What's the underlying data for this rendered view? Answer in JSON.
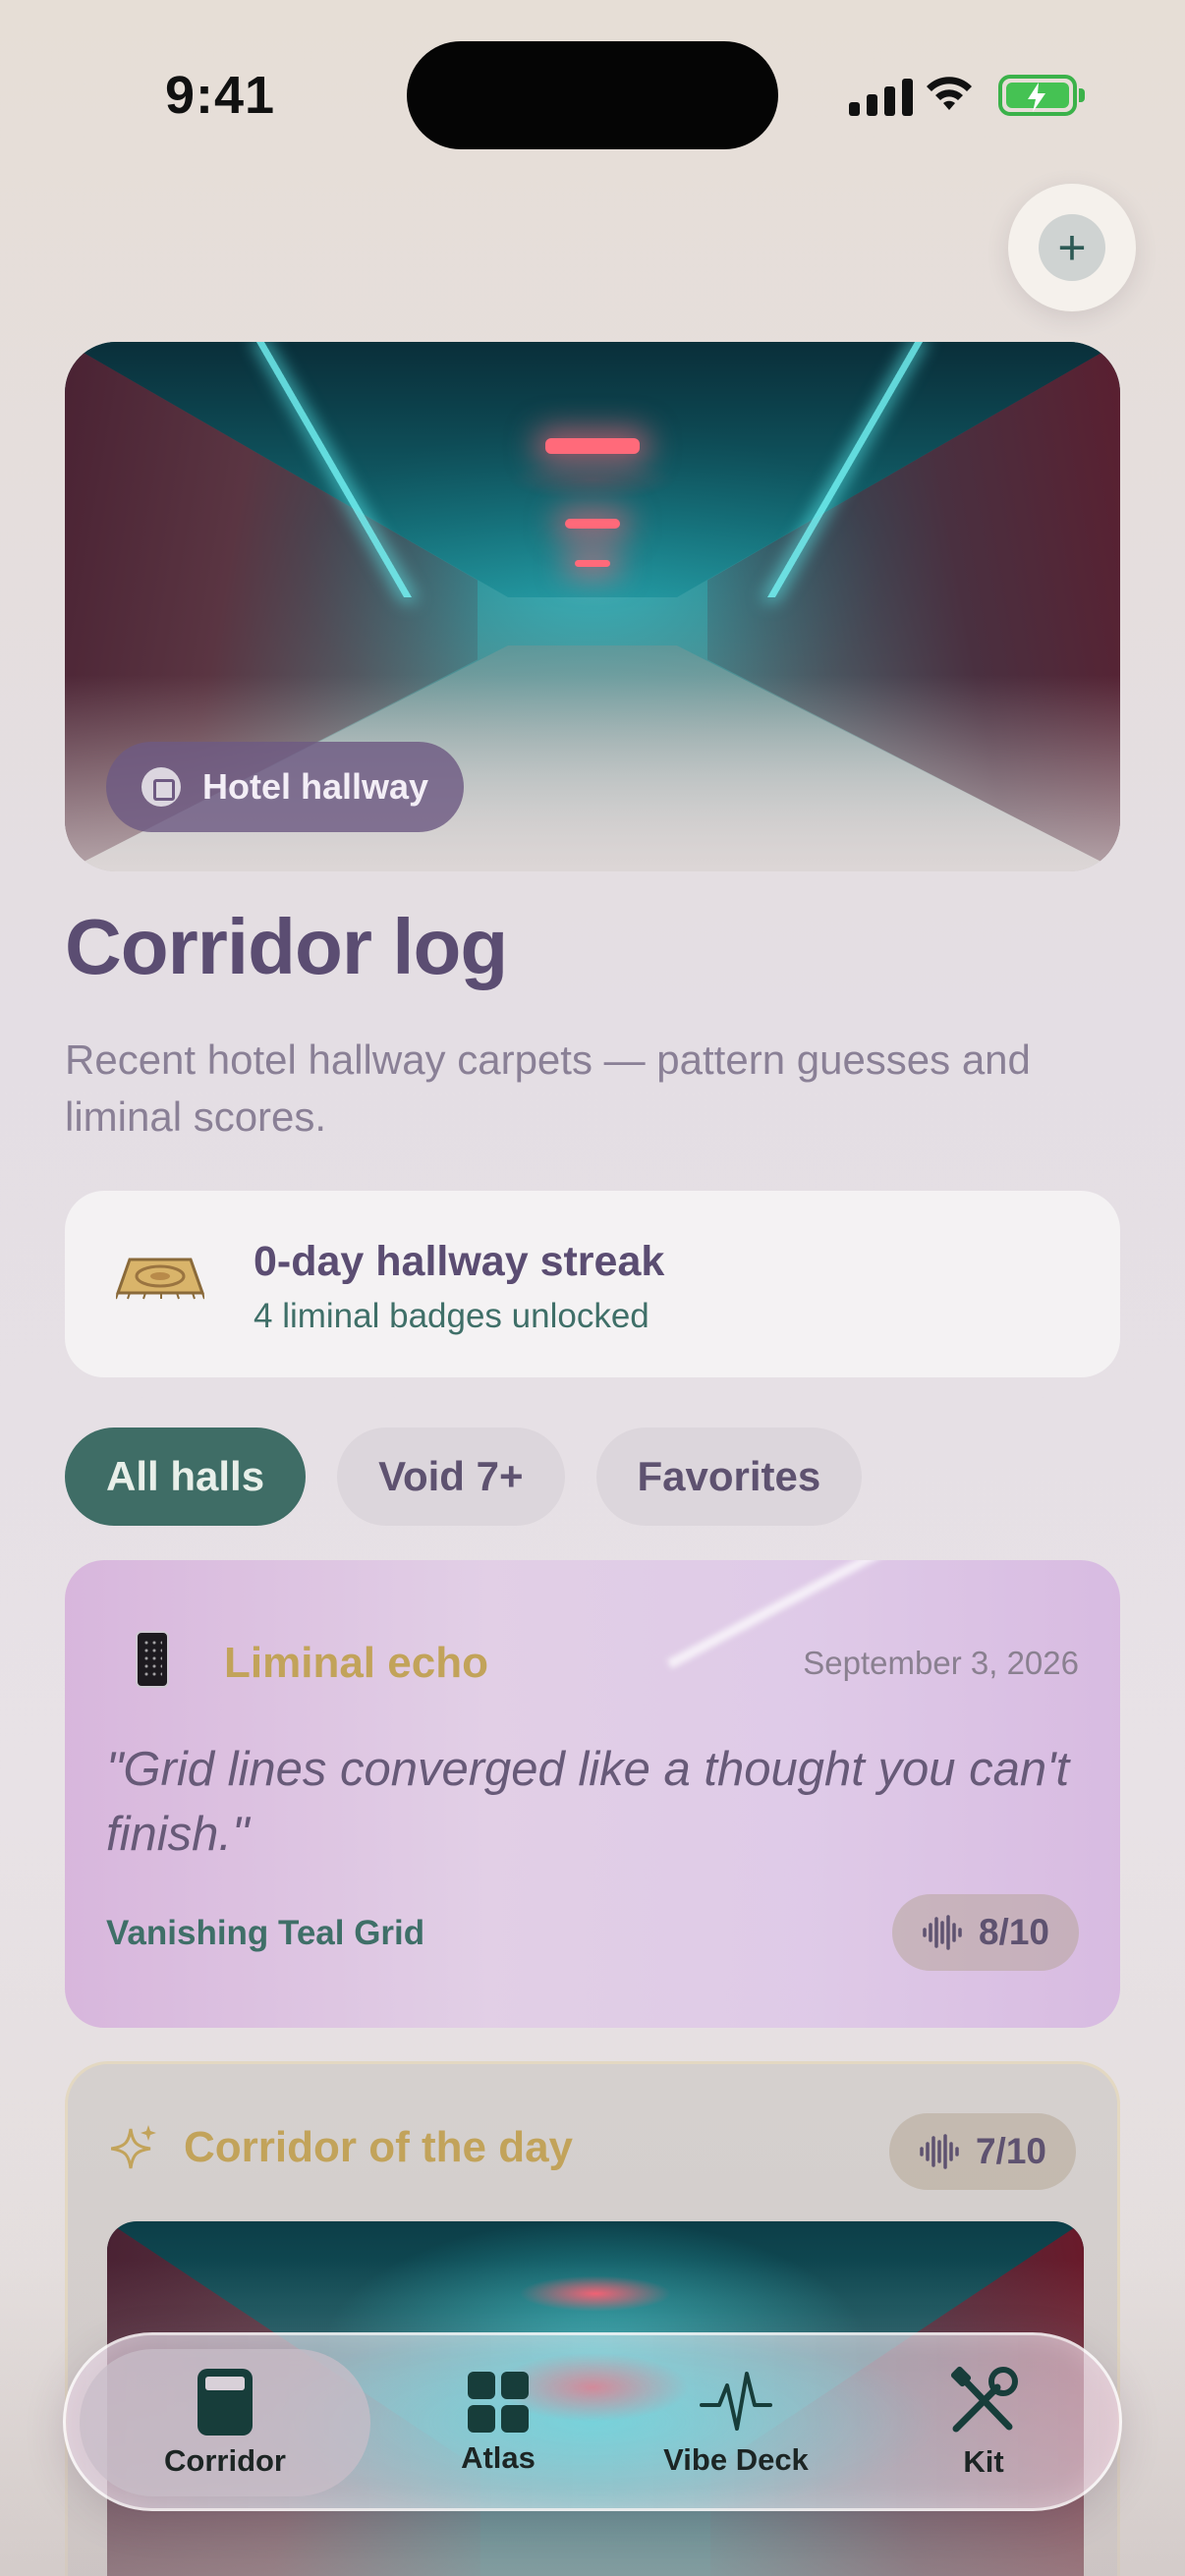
{
  "status": {
    "time": "9:41"
  },
  "hero": {
    "tag": "Hotel hallway"
  },
  "page": {
    "title": "Corridor log",
    "subtitle": "Recent hotel hallway carpets — pattern guesses and liminal scores."
  },
  "streak": {
    "headline": "0-day hallway streak",
    "badges": "4 liminal badges unlocked"
  },
  "filters": [
    {
      "label": "All halls",
      "active": true
    },
    {
      "label": "Void 7+",
      "active": false
    },
    {
      "label": "Favorites",
      "active": false
    }
  ],
  "entry": {
    "category": "Liminal echo",
    "date": "September 3, 2026",
    "quote": "\"Grid lines converged like a thought you can't finish.\"",
    "pattern": "Vanishing Teal Grid",
    "score": "8/10"
  },
  "daily": {
    "heading": "Corridor of the day",
    "score": "7/10"
  },
  "tabs": [
    {
      "label": "Corridor",
      "icon": "phone-card-icon",
      "active": true
    },
    {
      "label": "Atlas",
      "icon": "grid-icon",
      "active": false
    },
    {
      "label": "Vibe Deck",
      "icon": "waveform-icon",
      "active": false
    },
    {
      "label": "Kit",
      "icon": "tools-icon",
      "active": false
    }
  ],
  "colors": {
    "accent_teal": "#3f6d66",
    "title_purple": "#5b4d72",
    "gold": "#c2a35a"
  }
}
